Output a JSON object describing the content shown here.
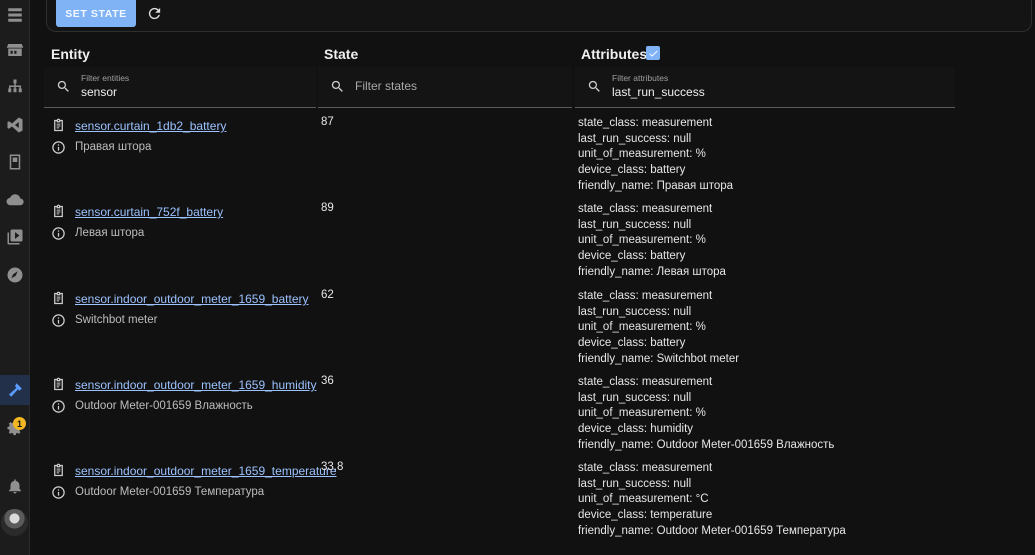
{
  "sidebar": {
    "icons": [
      "entities-icon",
      "hacs-icon",
      "network-icon",
      "vscode-icon",
      "tablet-icon",
      "cloud-icon",
      "media-icon",
      "compass-icon",
      "developer-tools-icon",
      "settings-icon",
      "bell-icon"
    ],
    "settings_badge": "1"
  },
  "toolbar": {
    "set_state_label": "SET STATE"
  },
  "columns": {
    "entity": "Entity",
    "state": "State",
    "attributes": "Attributes"
  },
  "filters": {
    "entity": {
      "label": "Filter entities",
      "value": "sensor"
    },
    "state": {
      "placeholder": "Filter states"
    },
    "attributes": {
      "label": "Filter attributes",
      "value": "last_run_success"
    }
  },
  "rows": [
    {
      "entity_id": "sensor.curtain_1db2_battery",
      "friendly_name": "Правая штора",
      "state": "87",
      "attributes": [
        "state_class: measurement",
        "last_run_success: null",
        "unit_of_measurement: %",
        "device_class: battery",
        "friendly_name: Правая штора"
      ]
    },
    {
      "entity_id": "sensor.curtain_752f_battery",
      "friendly_name": "Левая штора",
      "state": "89",
      "attributes": [
        "state_class: measurement",
        "last_run_success: null",
        "unit_of_measurement: %",
        "device_class: battery",
        "friendly_name: Левая штора"
      ]
    },
    {
      "entity_id": "sensor.indoor_outdoor_meter_1659_battery",
      "friendly_name": "Switchbot meter",
      "state": "62",
      "attributes": [
        "state_class: measurement",
        "last_run_success: null",
        "unit_of_measurement: %",
        "device_class: battery",
        "friendly_name: Switchbot meter"
      ]
    },
    {
      "entity_id": "sensor.indoor_outdoor_meter_1659_humidity",
      "friendly_name": "Outdoor Meter-001659 Влажность",
      "state": "36",
      "attributes": [
        "state_class: measurement",
        "last_run_success: null",
        "unit_of_measurement: %",
        "device_class: humidity",
        "friendly_name: Outdoor Meter-001659 Влажность"
      ]
    },
    {
      "entity_id": "sensor.indoor_outdoor_meter_1659_temperature",
      "friendly_name": "Outdoor Meter-001659 Температура",
      "state": "33.8",
      "attributes": [
        "state_class: measurement",
        "last_run_success: null",
        "unit_of_measurement: °C",
        "device_class: temperature",
        "friendly_name: Outdoor Meter-001659 Температура"
      ]
    }
  ],
  "colors": {
    "background": "#111111",
    "accent": "#7fb3f5",
    "link": "#9cc2ff",
    "badge": "#f2b722"
  }
}
